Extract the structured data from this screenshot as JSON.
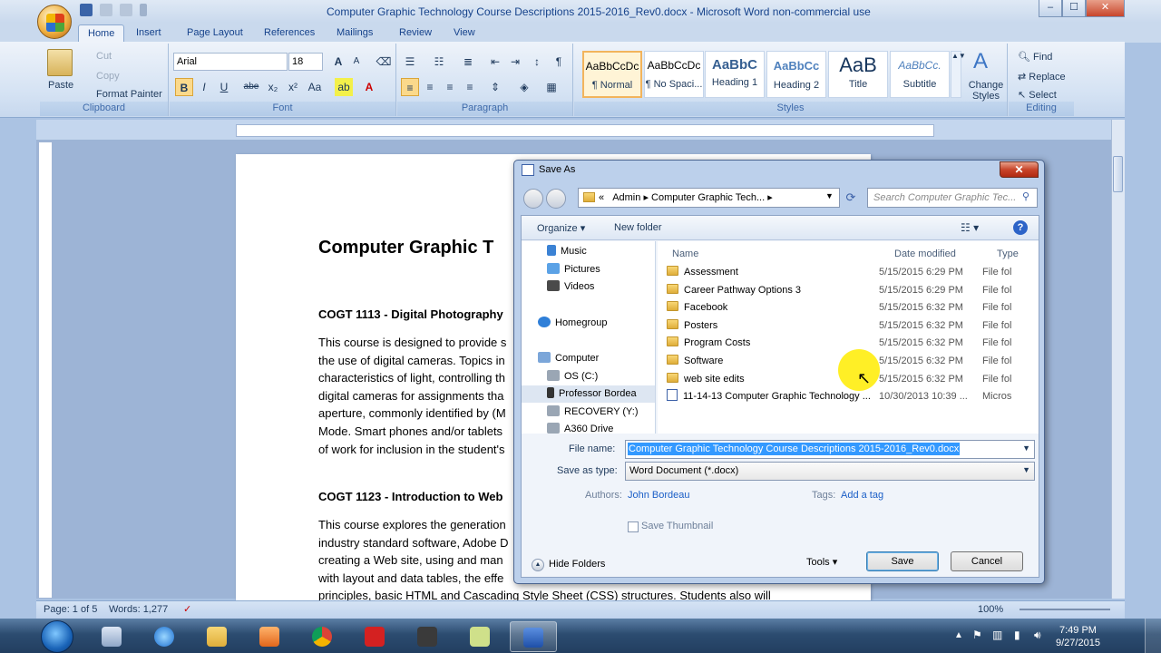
{
  "window": {
    "title": "Computer Graphic Technology Course Descriptions 2015-2016_Rev0.docx - Microsoft Word non-commercial use",
    "minimize": "–",
    "maximize": "☐",
    "close": "✕"
  },
  "tabs": [
    "Home",
    "Insert",
    "Page Layout",
    "References",
    "Mailings",
    "Review",
    "View"
  ],
  "clipboard": {
    "paste": "Paste",
    "cut": "Cut",
    "copy": "Copy",
    "format_painter": "Format Painter",
    "label": "Clipboard"
  },
  "font": {
    "name": "Arial",
    "size": "18",
    "label": "Font",
    "bold": "B",
    "italic": "I",
    "underline": "U",
    "strike": "abe",
    "sub": "x₂",
    "sup": "x²",
    "case": "Aa",
    "grow": "A",
    "shrink": "A"
  },
  "paragraph": {
    "label": "Paragraph"
  },
  "styles": {
    "label": "Styles",
    "items": [
      {
        "preview": "AaBbCcDc",
        "name": "¶ Normal"
      },
      {
        "preview": "AaBbCcDc",
        "name": "¶ No Spaci..."
      },
      {
        "preview": "AaBbC",
        "name": "Heading 1"
      },
      {
        "preview": "AaBbCc",
        "name": "Heading 2"
      },
      {
        "preview": "AaB",
        "name": "Title"
      },
      {
        "preview": "AaBbCc.",
        "name": "Subtitle"
      }
    ],
    "change_styles": "Change Styles"
  },
  "editing": {
    "label": "Editing",
    "find": "Find",
    "replace": "Replace",
    "select": "Select"
  },
  "document": {
    "title": "Computer Graphic T",
    "heading1": "COGT 1113 - Digital Photography",
    "para1": [
      "This course is designed to provide s",
      "the use of digital cameras. Topics in",
      "characteristics of light, controlling th",
      "digital cameras for assignments tha",
      "aperture, commonly identified by (M",
      "Mode. Smart phones and/or tablets",
      "of work for inclusion in the student's"
    ],
    "heading2": "COGT 1123 - Introduction to Web",
    "para2": [
      "This course explores the generation",
      "industry standard software, Adobe D",
      "creating a Web site, using and man",
      "with layout and data tables, the effe",
      "principles, basic HTML and Cascading Style Sheet (CSS) structures. Students also will"
    ]
  },
  "status": {
    "page": "Page: 1 of 5",
    "words": "Words: 1,277",
    "zoom": "100%"
  },
  "dialog": {
    "title": "Save As",
    "breadcrumb": [
      "«",
      "Admin",
      "Computer Graphic Tech..."
    ],
    "search_placeholder": "Search Computer Graphic Tec...",
    "organize": "Organize",
    "new_folder": "New folder",
    "nav": [
      "Music",
      "Pictures",
      "Videos",
      "Homegroup",
      "Computer",
      "OS (C:)",
      "Professor Bordea",
      "RECOVERY (Y:)",
      "A360 Drive"
    ],
    "columns": {
      "name": "Name",
      "date": "Date modified",
      "type": "Type"
    },
    "files": [
      {
        "name": "Assessment",
        "date": "5/15/2015 6:29 PM",
        "type": "File fol",
        "kind": "folder"
      },
      {
        "name": "Career Pathway Options 3",
        "date": "5/15/2015 6:29 PM",
        "type": "File fol",
        "kind": "folder"
      },
      {
        "name": "Facebook",
        "date": "5/15/2015 6:32 PM",
        "type": "File fol",
        "kind": "folder"
      },
      {
        "name": "Posters",
        "date": "5/15/2015 6:32 PM",
        "type": "File fol",
        "kind": "folder"
      },
      {
        "name": "Program Costs",
        "date": "5/15/2015 6:32 PM",
        "type": "File fol",
        "kind": "folder"
      },
      {
        "name": "Software",
        "date": "5/15/2015 6:32 PM",
        "type": "File fol",
        "kind": "folder"
      },
      {
        "name": "web site edits",
        "date": "5/15/2015 6:32 PM",
        "type": "File fol",
        "kind": "folder"
      },
      {
        "name": "11-14-13 Computer Graphic Technology ...",
        "date": "10/30/2013 10:39 ...",
        "type": "Micros",
        "kind": "doc"
      }
    ],
    "file_name_label": "File name:",
    "file_name_value": "Computer Graphic Technology Course Descriptions 2015-2016_Rev0.docx",
    "save_type_label": "Save as type:",
    "save_type_value": "Word Document (*.docx)",
    "authors_label": "Authors:",
    "authors_value": "John Bordeau",
    "tags_label": "Tags:",
    "tags_value": "Add a tag",
    "thumbnail": "Save Thumbnail",
    "hide_folders": "Hide Folders",
    "tools": "Tools",
    "save": "Save",
    "cancel": "Cancel"
  },
  "taskbar": {
    "time": "7:49 PM",
    "date": "9/27/2015"
  }
}
